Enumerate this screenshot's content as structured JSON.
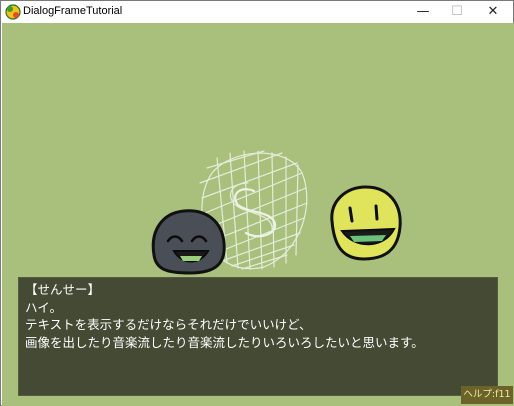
{
  "window": {
    "title": "DialogFrameTutorial",
    "minimize_glyph": "—",
    "maximize_glyph": "☐",
    "close_glyph": "✕"
  },
  "scene": {
    "background_color": "#a8c07c",
    "characters": [
      {
        "name": "dark-blob-character",
        "color": "#4a4f55"
      },
      {
        "name": "yellow-blob-character",
        "color": "#dfe45a"
      }
    ],
    "scribble_emblem": "S"
  },
  "dialog": {
    "lines": [
      "【せんせー】",
      "ハイ。",
      "テキストを表示するだけならそれだけでいいけど、",
      "画像を出したり音楽流したり音楽流したりいろいろしたいと思います。"
    ]
  },
  "help": {
    "label": "ヘルプ:f11"
  }
}
